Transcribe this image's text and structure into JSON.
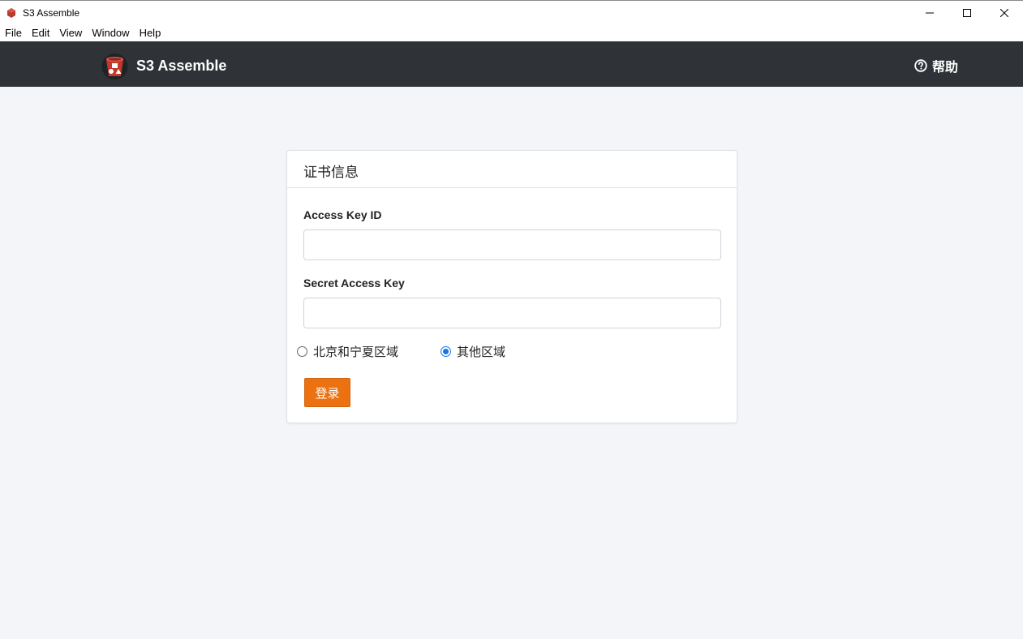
{
  "window": {
    "title": "S3 Assemble",
    "controls": {
      "minimize": "minimize-icon",
      "maximize": "maximize-icon",
      "close": "close-icon"
    }
  },
  "menubar": {
    "items": [
      "File",
      "Edit",
      "View",
      "Window",
      "Help"
    ]
  },
  "navbar": {
    "brand_name": "S3 Assemble",
    "help_label": "帮助",
    "background": "#2f3337"
  },
  "card": {
    "header": "证书信息",
    "access_key_label": "Access Key ID",
    "access_key_value": "",
    "secret_key_label": "Secret Access Key",
    "secret_key_value": "",
    "region_options": [
      {
        "label": "北京和宁夏区域",
        "selected": false
      },
      {
        "label": "其他区域",
        "selected": true
      }
    ],
    "login_label": "登录"
  },
  "colors": {
    "accent": "#ec7211",
    "radio_selected": "#1a73e8",
    "page_background": "#f3f5f8"
  }
}
